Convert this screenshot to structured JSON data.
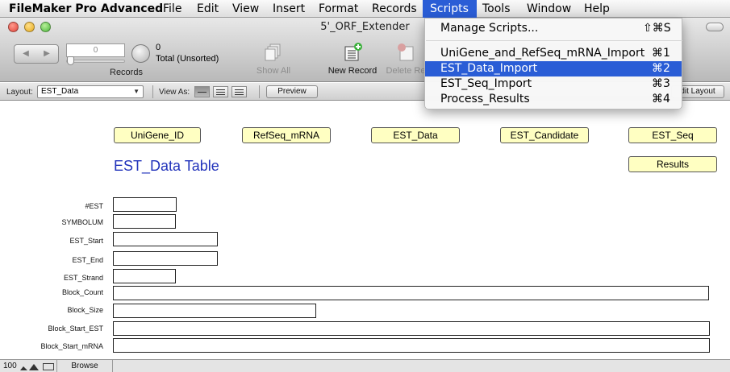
{
  "menubar": {
    "app": "FileMaker Pro Advanced",
    "items": [
      "File",
      "Edit",
      "View",
      "Insert",
      "Format",
      "Records",
      "Scripts",
      "Tools",
      "Window",
      "Help"
    ],
    "active_index": 6
  },
  "window": {
    "title": "5'_ORF_Extender"
  },
  "toolbar": {
    "record_number": "0",
    "found_count": "0",
    "total_label": "Total (Unsorted)",
    "records_label": "Records",
    "show_all": "Show All",
    "new_record": "New Record",
    "delete_record": "Delete Re"
  },
  "layout_bar": {
    "layout_label": "Layout:",
    "layout_value": "EST_Data",
    "view_as_label": "View As:",
    "preview": "Preview",
    "edit_layout": "dit Layout"
  },
  "content": {
    "nav_buttons": [
      "UniGene_ID",
      "RefSeq_mRNA",
      "EST_Data",
      "EST_Candidate",
      "EST_Seq",
      "Results"
    ],
    "title": "EST_Data Table",
    "fields": [
      {
        "label": "#EST",
        "value": ""
      },
      {
        "label": "SYMBOLUM",
        "value": ""
      },
      {
        "label": "EST_Start",
        "value": ""
      },
      {
        "label": "EST_End",
        "value": ""
      },
      {
        "label": "EST_Strand",
        "value": ""
      },
      {
        "label": "Block_Count",
        "value": ""
      },
      {
        "label": "Block_Size",
        "value": ""
      },
      {
        "label": "Block_Start_EST",
        "value": ""
      },
      {
        "label": "Block_Start_mRNA",
        "value": ""
      }
    ]
  },
  "status_bar": {
    "zoom": "100",
    "mode": "Browse"
  },
  "scripts_menu": {
    "items": [
      {
        "label": "Manage Scripts...",
        "shortcut": "⇧⌘S"
      },
      {
        "label": "UniGene_and_RefSeq_mRNA_Import",
        "shortcut": "⌘1"
      },
      {
        "label": "EST_Data_Import",
        "shortcut": "⌘2"
      },
      {
        "label": "EST_Seq_Import",
        "shortcut": "⌘3"
      },
      {
        "label": "Process_Results",
        "shortcut": "⌘4"
      }
    ],
    "highlighted_index": 2
  },
  "colors": {
    "accent": "#2a5dd6",
    "button_fill": "#ffffc2",
    "title_color": "#2233bb"
  },
  "icons": [
    "book-icon",
    "pie-icon",
    "show-all-icon",
    "new-record-icon",
    "delete-record-icon"
  ]
}
